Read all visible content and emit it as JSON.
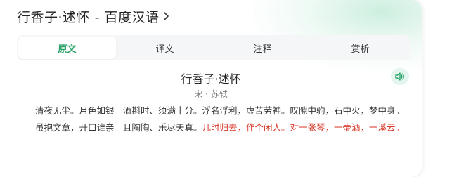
{
  "header": {
    "title": "行香子·述怀 - 百度汉语",
    "chevron_icon": "chevron-right-icon"
  },
  "tabs": [
    {
      "label": "原文",
      "active": true
    },
    {
      "label": "译文",
      "active": false
    },
    {
      "label": "注释",
      "active": false
    },
    {
      "label": "赏析",
      "active": false
    }
  ],
  "poem": {
    "title": "行香子·述怀",
    "author": "宋 · 苏轼",
    "audio_icon": "speaker-icon",
    "para1": "清夜无尘。月色如银。酒斟时、须满十分。浮名浮利，虚苦劳神。叹隙中驹，石中火，梦中身。",
    "para2_normal": "虽抱文章，开口谁亲。且陶陶、乐尽天真。",
    "para2_highlight": "几时归去，作个闲人。对一张琴，一壶酒，一溪云。"
  },
  "colors": {
    "accent": "#2ba36a",
    "highlight": "#d9382a",
    "audio_bg": "#e4f5ee"
  }
}
